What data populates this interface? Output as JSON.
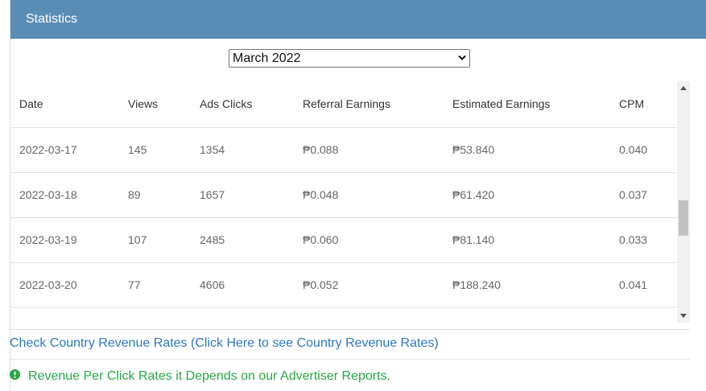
{
  "panel": {
    "title": "Statistics"
  },
  "month_select": {
    "value": "March 2022"
  },
  "table": {
    "columns": [
      "Date",
      "Views",
      "Ads Clicks",
      "Referral Earnings",
      "Estimated Earnings",
      "CPM"
    ],
    "rows": [
      [
        "2022-03-17",
        "145",
        "1354",
        "₱0.088",
        "₱53.840",
        "0.040"
      ],
      [
        "2022-03-18",
        "89",
        "1657",
        "₱0.048",
        "₱61.420",
        "0.037"
      ],
      [
        "2022-03-19",
        "107",
        "2485",
        "₱0.060",
        "₱81.140",
        "0.033"
      ],
      [
        "2022-03-20",
        "77",
        "4606",
        "₱0.052",
        "₱188.240",
        "0.041"
      ],
      [
        "",
        "",
        "",
        "",
        "",
        ""
      ]
    ]
  },
  "links": {
    "country_rates": "Check Country Revenue Rates (Click Here to see Country Revenue Rates)"
  },
  "notice": {
    "text": "Revenue Per Click Rates it Depends on our Advertiser Reports.",
    "icon": "exclamation-circle-icon",
    "color": "#28a745"
  },
  "colors": {
    "header_bg": "#5a8db5",
    "link": "#2f77c4"
  }
}
